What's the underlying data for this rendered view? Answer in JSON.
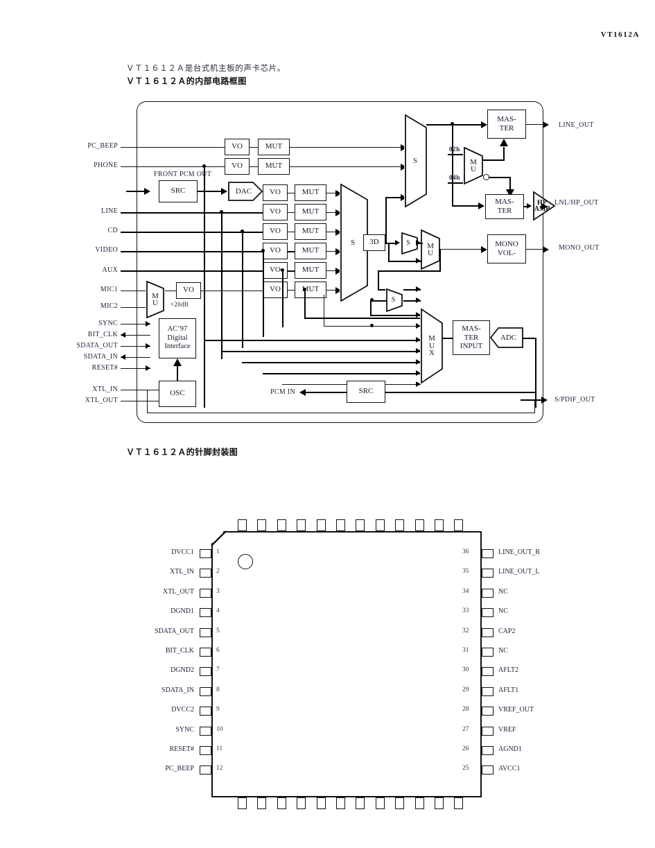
{
  "header": {
    "part_code": "VT1612A"
  },
  "intro": {
    "description": "ＶＴ１６１２Ａ是台式机主板的声卡芯片。",
    "block_diagram_title": "ＶＴ１６１２Ａ的内部电路框图",
    "package_diagram_title": "ＶＴ１６１２Ａ的针脚封装图"
  },
  "block_diagram": {
    "inputs": [
      {
        "label": "PC_BEEP"
      },
      {
        "label": "PHONE"
      },
      {
        "label": "LINE"
      },
      {
        "label": "CD"
      },
      {
        "label": "VIDEO"
      },
      {
        "label": "AUX"
      },
      {
        "label": "MIC1"
      },
      {
        "label": "MIC2"
      },
      {
        "label": "SYNC"
      },
      {
        "label": "BIT_CLK"
      },
      {
        "label": "SDATA_OUT"
      },
      {
        "label": "SDATA_IN"
      },
      {
        "label": "RESET#"
      },
      {
        "label": "XTL_IN"
      },
      {
        "label": "XTL_OUT"
      }
    ],
    "outputs": [
      {
        "label": "LINE_OUT"
      },
      {
        "label": "LNL/HP_OUT"
      },
      {
        "label": "MONO_OUT"
      },
      {
        "label": "S/PDIF_OUT"
      }
    ],
    "internal_labels": {
      "front_pcm_out": "FRONT PCM OUT",
      "pcm_in": "PCM IN",
      "mic_gain": "+20dB",
      "mux_sel_a": "02h",
      "mux_sel_b": "04h"
    },
    "blocks": {
      "src_in": "SRC",
      "src_out": "SRC",
      "dac": "DAC",
      "adc": "ADC",
      "vo": "VO",
      "mut": "MUT",
      "three_d": "3D",
      "sum": "S",
      "mu": "M\nU",
      "mux": "M\nU\nX",
      "master": "MAS-\nTER",
      "master_line1": "MAS-",
      "master_line2": "TER",
      "master_input_line1": "MAS-",
      "master_input_line2": "TER",
      "master_input_line3": "INPUT",
      "mono_vol_line1": "MONO",
      "mono_vol_line2": "VOL-",
      "hp_amp_line1": "HP",
      "hp_amp_line2": "AMP",
      "ac97_line1": "AC’97",
      "ac97_line2": "Digital",
      "ac97_line3": "Interface",
      "osc": "OSC"
    },
    "vo_mut_rows": [
      {
        "vo": "VO",
        "mut": "MUT"
      },
      {
        "vo": "VO",
        "mut": "MUT"
      },
      {
        "vo": "VO",
        "mut": "MUT"
      },
      {
        "vo": "VO",
        "mut": "MUT"
      },
      {
        "vo": "VO",
        "mut": "MUT"
      },
      {
        "vo": "VO",
        "mut": "MUT"
      },
      {
        "vo": "VO",
        "mut": "MUT"
      },
      {
        "vo": "VO",
        "mut": "MUT"
      }
    ]
  },
  "package": {
    "left_pins": [
      {
        "num": "1",
        "name": "DVCC1"
      },
      {
        "num": "2",
        "name": "XTL_IN"
      },
      {
        "num": "3",
        "name": "XTL_OUT"
      },
      {
        "num": "4",
        "name": "DGND1"
      },
      {
        "num": "5",
        "name": "SDATA_OUT"
      },
      {
        "num": "6",
        "name": "BIT_CLK"
      },
      {
        "num": "7",
        "name": "DGND2"
      },
      {
        "num": "8",
        "name": "SDATA_IN"
      },
      {
        "num": "9",
        "name": "DVCC2"
      },
      {
        "num": "10",
        "name": "SYNC"
      },
      {
        "num": "11",
        "name": "RESET#"
      },
      {
        "num": "12",
        "name": "PC_BEEP"
      }
    ],
    "right_pins": [
      {
        "num": "36",
        "name": "LINE_OUT_R"
      },
      {
        "num": "35",
        "name": "LINE_OUT_L"
      },
      {
        "num": "34",
        "name": "NC"
      },
      {
        "num": "33",
        "name": "NC"
      },
      {
        "num": "32",
        "name": "CAP2"
      },
      {
        "num": "31",
        "name": "NC"
      },
      {
        "num": "30",
        "name": "AFLT2"
      },
      {
        "num": "29",
        "name": "AFLT1"
      },
      {
        "num": "28",
        "name": "VREF_OUT"
      },
      {
        "num": "27",
        "name": "VREF"
      },
      {
        "num": "26",
        "name": "AGND1"
      },
      {
        "num": "25",
        "name": "AVCC1"
      }
    ],
    "top_pin_count": 12,
    "bottom_pin_count": 12
  },
  "colors": {
    "ink": "#111111",
    "text": "#1c2236",
    "pin_number": "#2a3a52",
    "background": "#ffffff"
  }
}
